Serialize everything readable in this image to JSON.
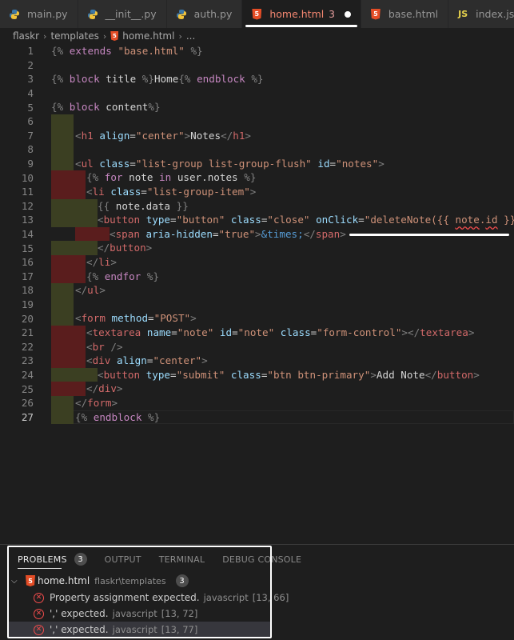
{
  "tabs": [
    {
      "label": "main.py",
      "icon": "python-icon"
    },
    {
      "label": "__init__.py",
      "icon": "python-icon"
    },
    {
      "label": "auth.py",
      "icon": "python-icon"
    },
    {
      "label": "home.html",
      "icon": "html-icon",
      "problems": "3",
      "active": true
    },
    {
      "label": "base.html",
      "icon": "html-icon"
    },
    {
      "label": "index.js",
      "icon": "js-icon"
    }
  ],
  "breadcrumb": {
    "folder1": "flaskr",
    "folder2": "templates",
    "file": "home.html",
    "more": "..."
  },
  "editor": {
    "lines": [
      {
        "n": "1"
      },
      {
        "n": "2"
      },
      {
        "n": "3"
      },
      {
        "n": "4"
      },
      {
        "n": "5"
      },
      {
        "n": "6"
      },
      {
        "n": "7"
      },
      {
        "n": "8"
      },
      {
        "n": "9"
      },
      {
        "n": "10"
      },
      {
        "n": "11"
      },
      {
        "n": "12"
      },
      {
        "n": "13"
      },
      {
        "n": "14"
      },
      {
        "n": "15"
      },
      {
        "n": "16"
      },
      {
        "n": "17"
      },
      {
        "n": "18"
      },
      {
        "n": "19"
      },
      {
        "n": "20"
      },
      {
        "n": "21"
      },
      {
        "n": "22"
      },
      {
        "n": "23"
      },
      {
        "n": "24"
      },
      {
        "n": "25"
      },
      {
        "n": "26"
      },
      {
        "n": "27"
      }
    ],
    "code_text": [
      "{% extends \"base.html\" %}",
      "",
      "{% block title %}Home{% endblock %}",
      "",
      "{% block content%}",
      "",
      "<h1 align=\"center\">Notes</h1>",
      "",
      "<ul class=\"list-group list-group-flush\" id=\"notes\">",
      "{% for note in user.notes %}",
      "<li class=\"list-group-item\">",
      "{{ note.data }}",
      "<button type=\"button\" class=\"close\" onClick=\"deleteNote({{ note.id }})\">",
      "<span aria-hidden=\"true\">&times;</span>",
      "</button>",
      "</li>",
      "{% endfor %}",
      "</ul>",
      "",
      "<form method=\"POST\">",
      "<textarea name=\"note\" id=\"note\" class=\"form-control\"></textarea>",
      "<br />",
      "<div align=\"center\">",
      "<button type=\"submit\" class=\"btn btn-primary\">Add Note</button>",
      "</div>",
      "</form>",
      "{% endblock %}"
    ]
  },
  "panel": {
    "tabs": [
      {
        "label": "PROBLEMS",
        "count": "3",
        "active": true
      },
      {
        "label": "OUTPUT"
      },
      {
        "label": "TERMINAL"
      },
      {
        "label": "DEBUG CONSOLE"
      }
    ],
    "file": {
      "name": "home.html",
      "path": "flaskr\\templates",
      "count": "3"
    },
    "errors": [
      {
        "message": "Property assignment expected.",
        "source": "javascript",
        "position": "[13, 66]"
      },
      {
        "message": "',' expected.",
        "source": "javascript",
        "position": "[13, 72]"
      },
      {
        "message": "',' expected.",
        "source": "javascript",
        "position": "[13, 77]"
      }
    ]
  },
  "colors": {
    "background": "#1e1e1e",
    "tabbar": "#252526",
    "error": "#f14c4c",
    "html_icon": "#e44d26",
    "python_icon": "#3776ab",
    "js_icon": "#e8d44d"
  }
}
